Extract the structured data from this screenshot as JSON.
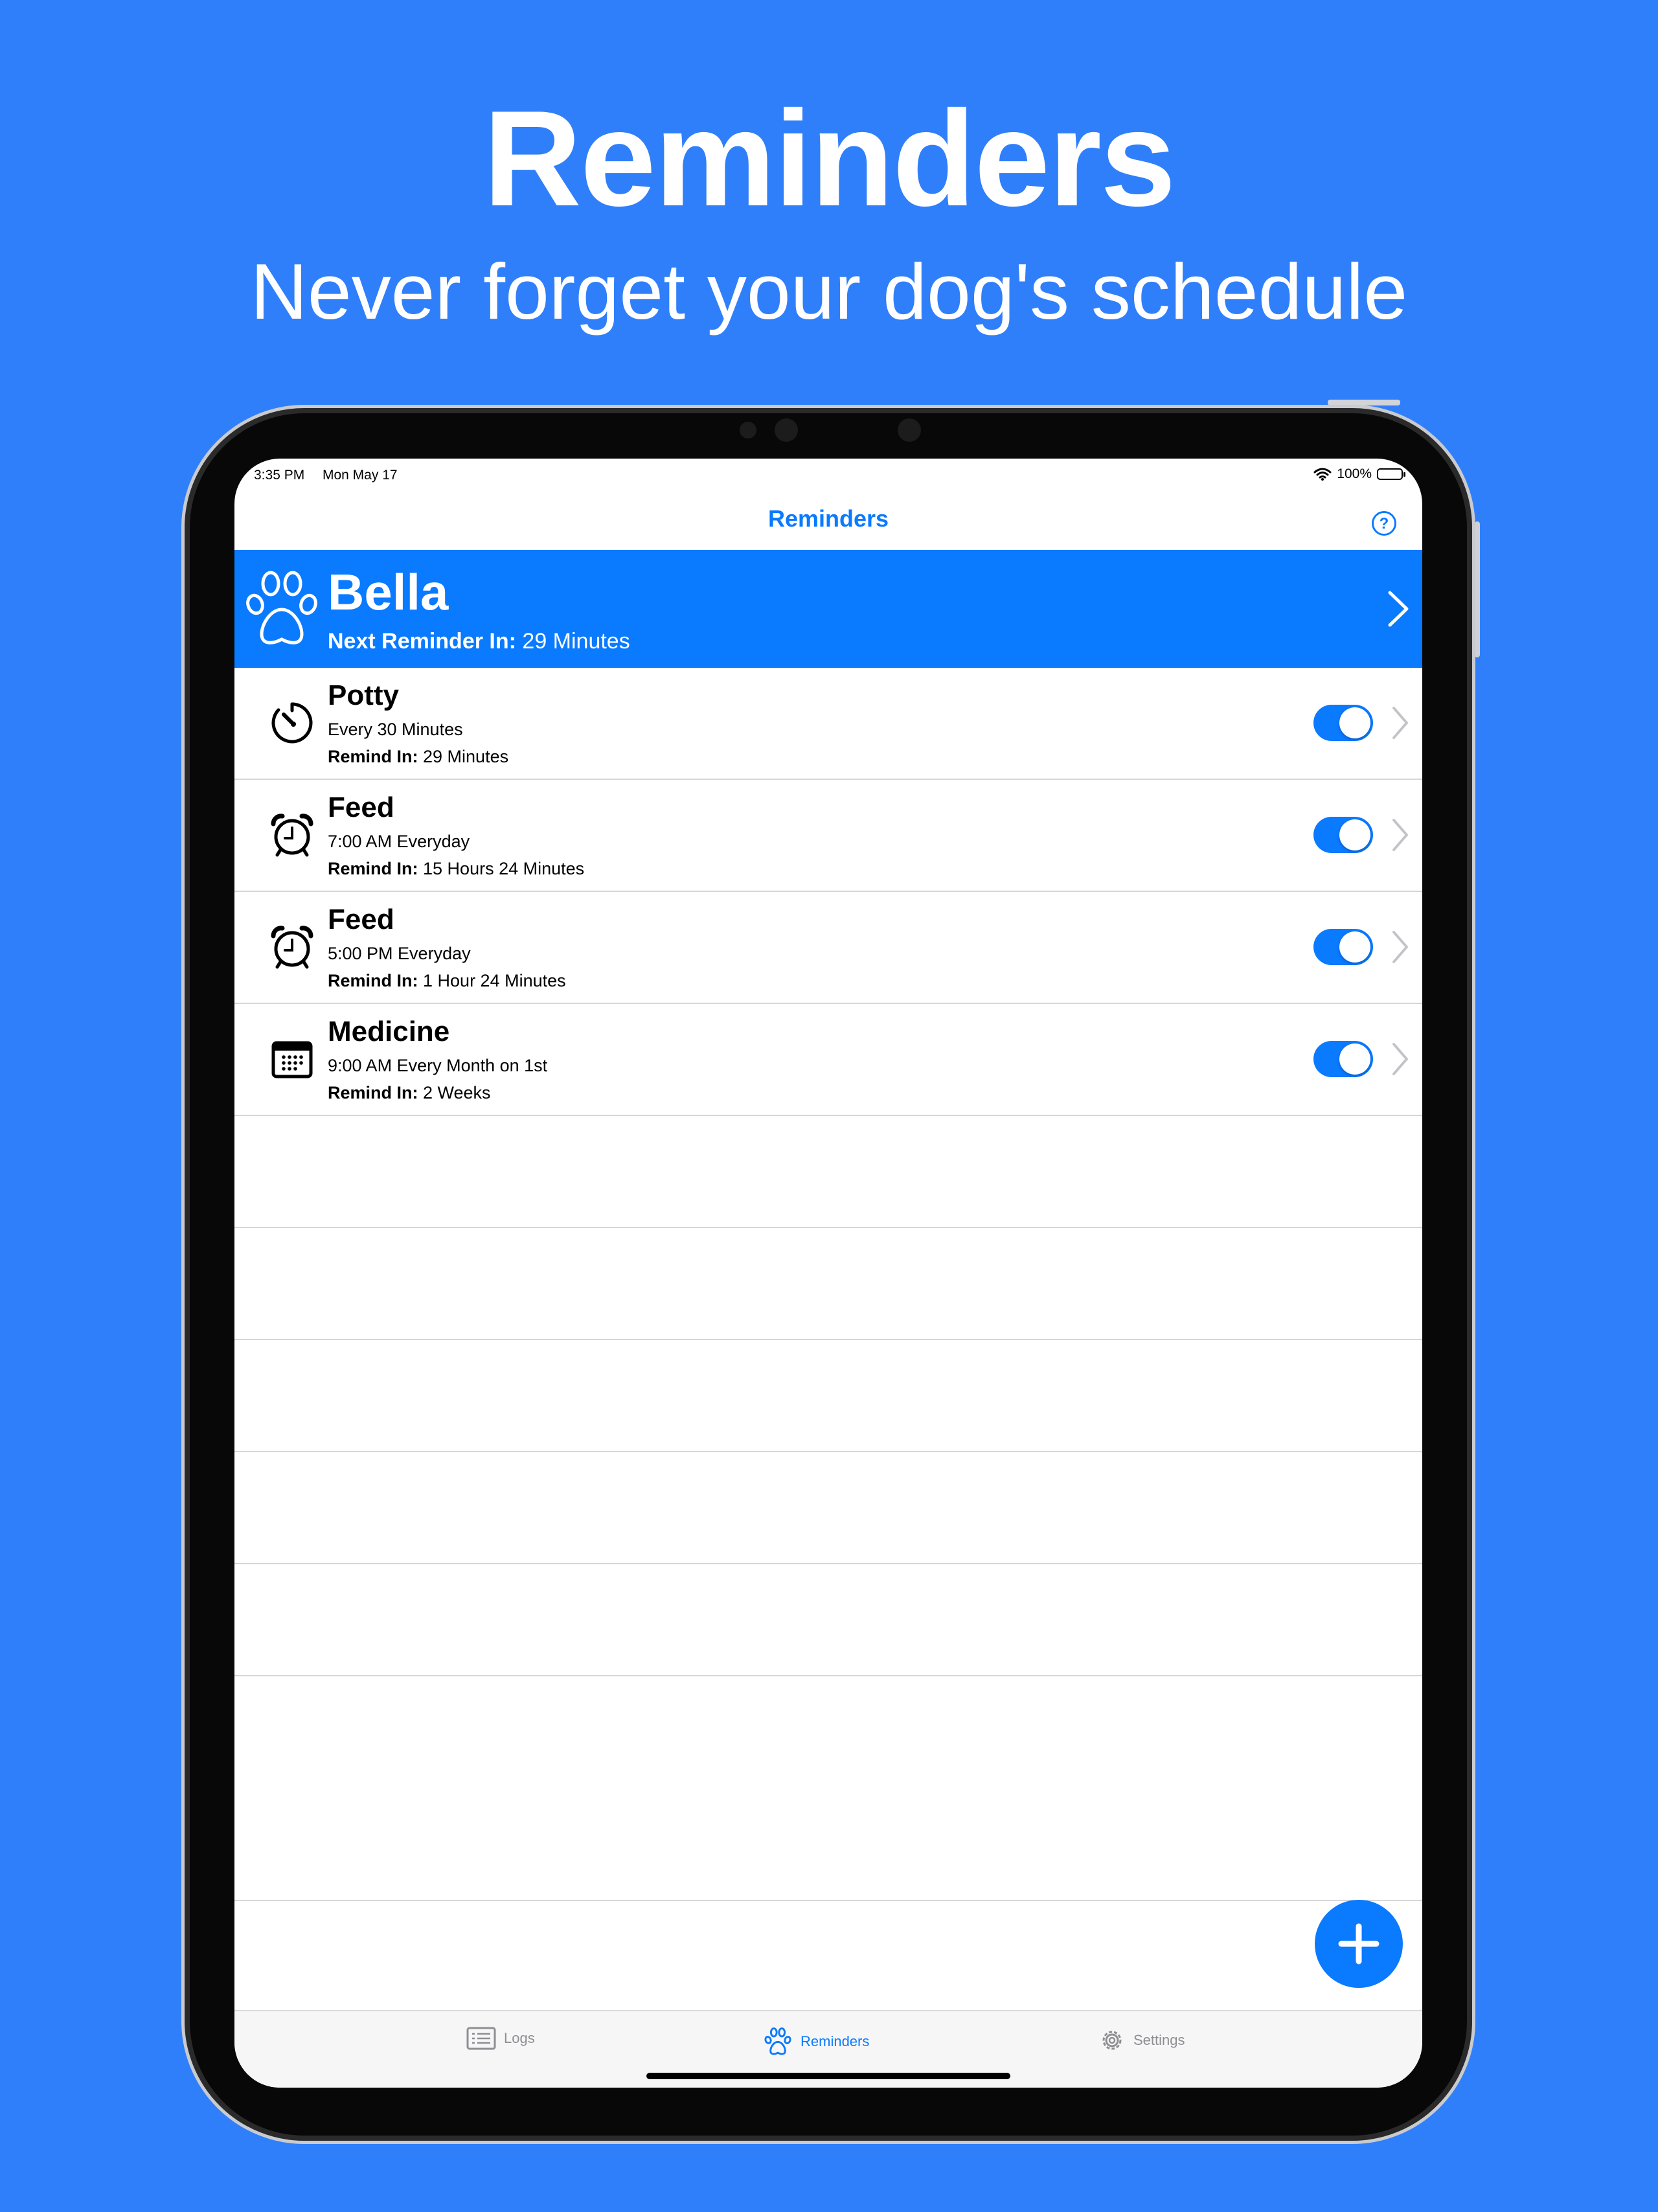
{
  "promo": {
    "title": "Reminders",
    "subtitle": "Never forget your dog's schedule"
  },
  "status_bar": {
    "time": "3:35 PM",
    "date": "Mon May 17",
    "battery": "100%"
  },
  "nav": {
    "title": "Reminders",
    "help_icon": "question-circle-icon"
  },
  "dog": {
    "name": "Bella",
    "next_label": "Next Reminder In:",
    "next_value": "29 Minutes",
    "icon": "paw-icon"
  },
  "reminders": [
    {
      "title": "Potty",
      "schedule": "Every 30 Minutes",
      "remind_label": "Remind In:",
      "remind_value": "29 Minutes",
      "icon": "timer-icon",
      "enabled": true
    },
    {
      "title": "Feed",
      "schedule": "7:00 AM Everyday",
      "remind_label": "Remind In:",
      "remind_value": "15 Hours 24 Minutes",
      "icon": "alarm-clock-icon",
      "enabled": true
    },
    {
      "title": "Feed",
      "schedule": "5:00 PM Everyday",
      "remind_label": "Remind In:",
      "remind_value": "1 Hour 24 Minutes",
      "icon": "alarm-clock-icon",
      "enabled": true
    },
    {
      "title": "Medicine",
      "schedule": "9:00 AM Every Month on 1st",
      "remind_label": "Remind In:",
      "remind_value": "2 Weeks",
      "icon": "calendar-icon",
      "enabled": true
    }
  ],
  "tabs": [
    {
      "label": "Logs",
      "icon": "list-icon",
      "active": false
    },
    {
      "label": "Reminders",
      "icon": "paw-icon",
      "active": true
    },
    {
      "label": "Settings",
      "icon": "gear-icon",
      "active": false
    }
  ],
  "colors": {
    "background": "#307ffa",
    "accent": "#0a7aff"
  }
}
